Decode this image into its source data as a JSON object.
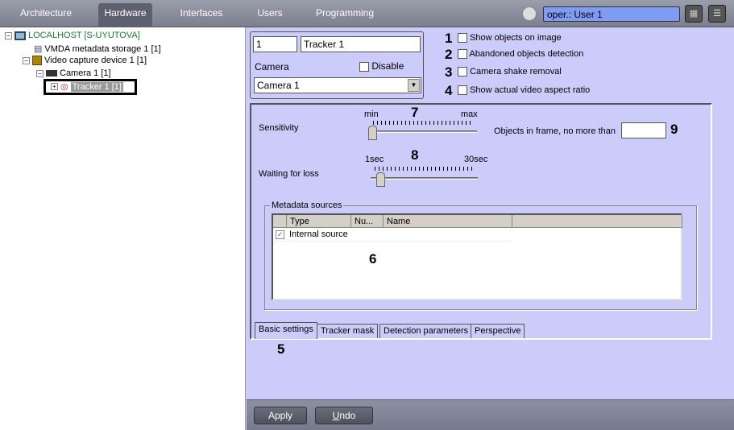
{
  "topbar": {
    "tabs": [
      "Architecture",
      "Hardware",
      "Interfaces",
      "Users",
      "Programming"
    ],
    "active_tab": "Hardware",
    "user_field": "oper.: User 1"
  },
  "tree": {
    "items": [
      "LOCALHOST [S-UYUTOVA]",
      "VMDA metadata storage 1 [1]",
      "Video capture device 1 [1]",
      "Camera 1 [1]",
      "Tracker 1 [1]"
    ]
  },
  "object": {
    "id": "1",
    "name": "Tracker 1",
    "camera_label": "Camera",
    "disable_label": "Disable",
    "camera_value": "Camera 1"
  },
  "options": [
    {
      "num": "1",
      "label": "Show objects on image",
      "checked": false
    },
    {
      "num": "2",
      "label": "Abandoned objects detection",
      "checked": false
    },
    {
      "num": "3",
      "label": "Camera shake removal",
      "checked": false
    },
    {
      "num": "4",
      "label": "Show actual video aspect ratio",
      "checked": false
    }
  ],
  "settings": {
    "sensitivity_label": "Sensitivity",
    "sens_min": "min",
    "sens_max": "max",
    "sens_num": "7",
    "sensitivity_value": 0.0,
    "wait_label": "Waiting for loss",
    "wait_min": "1sec",
    "wait_max": "30sec",
    "wait_num": "8",
    "wait_value": 0.05,
    "objects_label": "Objects in frame, no more than",
    "objects_value": "",
    "objects_num": "9",
    "metadata_title": "Metadata sources",
    "columns": [
      "Type",
      "Nu...",
      "Name"
    ],
    "rows": [
      {
        "type": "Internal source",
        "num": "",
        "name": "",
        "checked": true
      }
    ],
    "table_num": "6"
  },
  "tabs": {
    "items": [
      "Basic settings",
      "Tracker mask",
      "Detection parameters",
      "Perspective"
    ],
    "active": "Basic settings",
    "num": "5"
  },
  "bottom": {
    "apply": "Apply",
    "undo": "Undo"
  }
}
